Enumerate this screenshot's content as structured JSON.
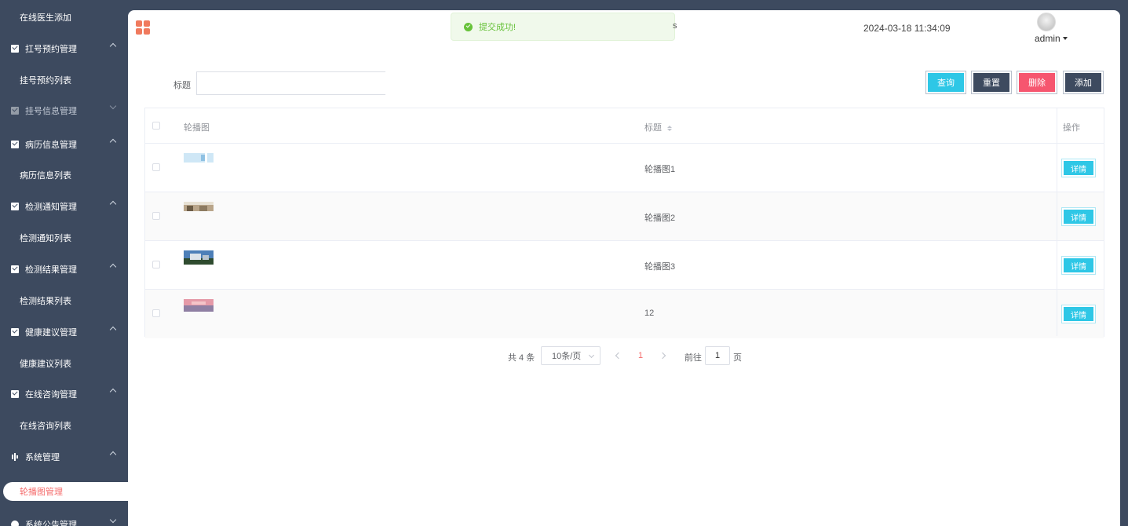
{
  "sidebar": {
    "items": [
      {
        "label": "在线医生添加",
        "kind": "sub"
      },
      {
        "label": "扛号预约管理",
        "kind": "group"
      },
      {
        "label": "挂号预约列表",
        "kind": "sub"
      },
      {
        "label": "挂号信息管理",
        "kind": "group"
      },
      {
        "label": "病历信息管理",
        "kind": "group"
      },
      {
        "label": "病历信息列表",
        "kind": "sub"
      },
      {
        "label": "检测通知管理",
        "kind": "group"
      },
      {
        "label": "检测通知列表",
        "kind": "sub"
      },
      {
        "label": "检测结果管理",
        "kind": "group"
      },
      {
        "label": "检测结果列表",
        "kind": "sub"
      },
      {
        "label": "健康建议管理",
        "kind": "group"
      },
      {
        "label": "健康建议列表",
        "kind": "sub"
      },
      {
        "label": "在线咨询管理",
        "kind": "group"
      },
      {
        "label": "在线咨询列表",
        "kind": "sub"
      },
      {
        "label": "系统管理",
        "kind": "group"
      },
      {
        "label": "轮播图管理",
        "kind": "active"
      },
      {
        "label": "系统公告管理",
        "kind": "group"
      }
    ]
  },
  "header": {
    "toast": "提交成功!",
    "datetime": "2024-03-18 11:34:09",
    "user": "admin"
  },
  "search": {
    "label": "标题",
    "value": "",
    "buttons": {
      "query": "查询",
      "reset": "重置",
      "delete": "删除",
      "add": "添加"
    }
  },
  "table": {
    "headers": {
      "image": "轮播图",
      "title": "标题",
      "action": "操作"
    },
    "rows": [
      {
        "title": "轮播图1",
        "action": "详情"
      },
      {
        "title": "轮播图2",
        "action": "详情"
      },
      {
        "title": "轮播图3",
        "action": "详情"
      },
      {
        "title": "12",
        "action": "详情"
      }
    ]
  },
  "pagination": {
    "total": "共 4 条",
    "page_size": "10条/页",
    "current_page": "1",
    "goto": "前往",
    "goto_value": "1",
    "unit": "页"
  },
  "colors": {
    "sidebar_bg": "#3d4a5f",
    "primary_cyan": "#2ec7e6",
    "danger": "#f6566f",
    "accent": "#f56c6c",
    "success": "#67c23a"
  }
}
